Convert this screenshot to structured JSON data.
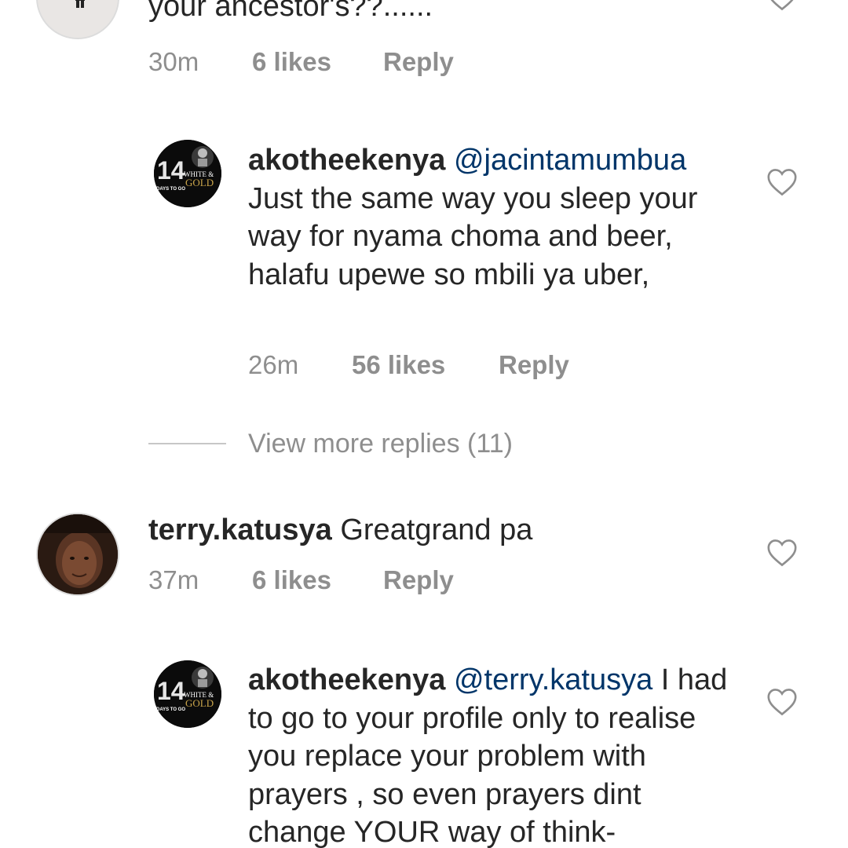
{
  "comments": [
    {
      "text_tail": "your ancestor's??......",
      "time": "30m",
      "likes": "6 likes",
      "reply": "Reply"
    },
    {
      "username": "akotheekenya",
      "mention": "@jacintamumbua",
      "text": "Just the same way you sleep your way for nyama choma and beer,  halafu upewe so mbili ya uber,",
      "time": "26m",
      "likes": "56 likes",
      "reply": "Reply",
      "avatar_text": {
        "days": "14",
        "days_label": "DAYS TO GO",
        "line1": "WHITE &",
        "line2": "GOLD"
      }
    },
    {
      "username": "terry.katusya",
      "text": "Greatgrand pa",
      "time": "37m",
      "likes": "6 likes",
      "reply": "Reply"
    },
    {
      "username": "akotheekenya",
      "mention": "@terry.katusya",
      "text": "I had to go to your profile only to realise you replace your problem with prayers , so even prayers dint change YOUR way of think-",
      "avatar_text": {
        "days": "14",
        "days_label": "DAYS TO GO",
        "line1": "WHITE &",
        "line2": "GOLD"
      }
    }
  ],
  "view_more": "View more replies (11)",
  "colors": {
    "text": "#262626",
    "meta": "#8e8e8e",
    "mention": "#003569",
    "divider": "#c7c7c7"
  }
}
